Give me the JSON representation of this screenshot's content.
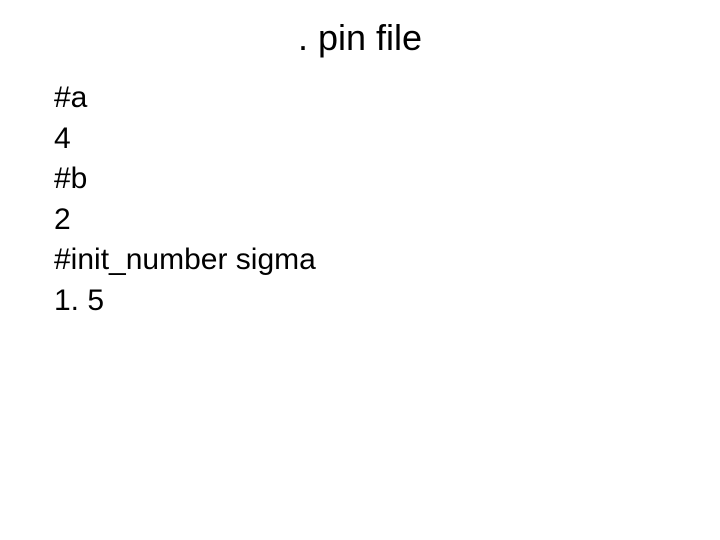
{
  "title": ". pin file",
  "lines": {
    "l0": "#a",
    "l1": "4",
    "l2": "#b",
    "l3": "2",
    "l4": "#init_number sigma",
    "l5": "1. 5"
  }
}
